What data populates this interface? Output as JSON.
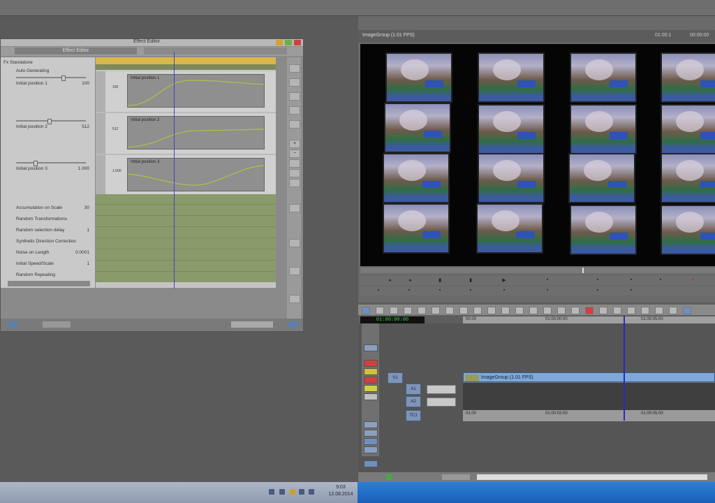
{
  "app": {
    "title": ""
  },
  "effect_editor": {
    "title": "Effect Editor",
    "effect_name": "Effect Editor",
    "params": [
      {
        "label": "Fx  Standalone",
        "value": ""
      },
      {
        "label": "Auto Generating",
        "value": ""
      },
      {
        "label": "Initial position 1",
        "value": "100"
      },
      {
        "label": "Initial position 2",
        "value": "512"
      },
      {
        "label": "Initial position 3",
        "value": "1.000"
      },
      {
        "label": "Accumulation on Scale",
        "value": "30"
      },
      {
        "label": "Random Transformations",
        "value": ""
      },
      {
        "label": "Random selection delay",
        "value": "1"
      },
      {
        "label": "Synthetic Direction Correction",
        "value": ""
      },
      {
        "label": "Noise on Length",
        "value": "0.0001"
      },
      {
        "label": "Initial Speed/Scale",
        "value": "1"
      },
      {
        "label": "Random Repeating",
        "value": ""
      }
    ],
    "graphs": [
      {
        "title": "Initial position 1",
        "yval": "100"
      },
      {
        "title": "Initial position 2",
        "yval": "512"
      },
      {
        "title": "Initial position 3",
        "yval": "1.000"
      }
    ]
  },
  "monitor": {
    "clip_name": "ImageGroup (1.01 FPS)",
    "tc1": "01:00:1",
    "tc2": "00:00:00"
  },
  "timeline": {
    "master_tc": "01:00:00:00",
    "ruler": [
      "00:00",
      "01:00:00:00",
      "01:00:05:00"
    ],
    "clip_label": "ImageGroup (1.01 FPS)",
    "tc_row": [
      "01:00",
      "01:00:02:00",
      "01:00:05:00"
    ],
    "tracks": [
      "V1",
      "A1",
      "A2",
      "TC1"
    ]
  },
  "taskbar": {
    "time": "9:03",
    "date": "12.08.2014"
  },
  "colors": {
    "accent_blue": "#7fa8d8",
    "playhead": "#4040c0",
    "taskbar_blue": "#1a5fb8"
  }
}
